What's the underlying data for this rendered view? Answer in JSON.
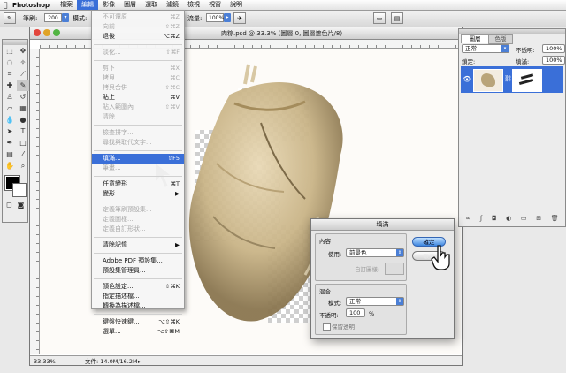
{
  "menubar": {
    "app": "Photoshop",
    "items": [
      "檔案",
      "編輯",
      "影像",
      "圖層",
      "選取",
      "濾鏡",
      "檢視",
      "視窗",
      "說明"
    ],
    "active_index": 1
  },
  "options_bar": {
    "brush_label": "筆刷:",
    "brush_size": "200",
    "mode_label": "模式:",
    "flow_label": "流量:",
    "flow_value": "100%"
  },
  "document": {
    "title": "肉粽.psd @ 33.3% (圖層 0, 圖層遮色片/8)",
    "zoom": "33.33%",
    "file_info": "文件: 14.0M/16.2M"
  },
  "edit_menu": {
    "items": [
      {
        "label": "不可還原",
        "shortcut": "⌘Z",
        "disabled": true
      },
      {
        "label": "向前",
        "shortcut": "⇧⌘Z",
        "disabled": true
      },
      {
        "label": "退後",
        "shortcut": "⌥⌘Z",
        "disabled": false
      },
      {
        "sep": true
      },
      {
        "label": "淡化...",
        "shortcut": "⇧⌘F",
        "disabled": true
      },
      {
        "sep": true
      },
      {
        "label": "剪下",
        "shortcut": "⌘X",
        "disabled": true
      },
      {
        "label": "拷貝",
        "shortcut": "⌘C",
        "disabled": true
      },
      {
        "label": "拷貝合併",
        "shortcut": "⇧⌘C",
        "disabled": true
      },
      {
        "label": "貼上",
        "shortcut": "⌘V",
        "disabled": false
      },
      {
        "label": "貼入範圍內",
        "shortcut": "⇧⌘V",
        "disabled": true
      },
      {
        "label": "清除",
        "shortcut": "",
        "disabled": true
      },
      {
        "sep": true
      },
      {
        "label": "檢查拼字...",
        "shortcut": "",
        "disabled": true
      },
      {
        "label": "尋找與取代文字...",
        "shortcut": "",
        "disabled": true
      },
      {
        "sep": true
      },
      {
        "label": "填滿...",
        "shortcut": "⇧F5",
        "disabled": false,
        "highlighted": true
      },
      {
        "label": "筆畫...",
        "shortcut": "",
        "disabled": true
      },
      {
        "sep": true
      },
      {
        "label": "任意變形",
        "shortcut": "⌘T",
        "disabled": false
      },
      {
        "label": "變形",
        "shortcut": "▶",
        "disabled": false
      },
      {
        "sep": true
      },
      {
        "label": "定義筆刷預設集...",
        "shortcut": "",
        "disabled": true
      },
      {
        "label": "定義圖樣...",
        "shortcut": "",
        "disabled": true
      },
      {
        "label": "定義自訂形狀...",
        "shortcut": "",
        "disabled": true
      },
      {
        "sep": true
      },
      {
        "label": "清除記憶",
        "shortcut": "▶",
        "disabled": false
      },
      {
        "sep": true
      },
      {
        "label": "Adobe PDF 預設集...",
        "shortcut": "",
        "disabled": false
      },
      {
        "label": "預設集管理員...",
        "shortcut": "",
        "disabled": false
      },
      {
        "sep": true
      },
      {
        "label": "顏色設定...",
        "shortcut": "⇧⌘K",
        "disabled": false
      },
      {
        "label": "指定描述檔...",
        "shortcut": "",
        "disabled": false
      },
      {
        "label": "轉換為描述檔...",
        "shortcut": "",
        "disabled": false
      },
      {
        "sep": true
      },
      {
        "label": "鍵盤快速鍵...",
        "shortcut": "⌥⇧⌘K",
        "disabled": false
      },
      {
        "label": "選單...",
        "shortcut": "⌥⇧⌘M",
        "disabled": false
      }
    ]
  },
  "layers_panel": {
    "tabs": [
      "圖層",
      "色版"
    ],
    "blend_mode": "正常",
    "opacity_label": "不透明:",
    "opacity_value": "100%",
    "lock_label": "鎖定:",
    "fill_label": "填滿:",
    "fill_value": "100%"
  },
  "fill_dialog": {
    "title": "填滿",
    "content_group": "內容",
    "use_label": "使用:",
    "use_value": "前景色",
    "custom_pattern_label": "自訂圖樣:",
    "blend_group": "混合",
    "mode_label": "模式:",
    "mode_value": "正常",
    "opacity_label": "不透明:",
    "opacity_value": "100",
    "opacity_unit": "%",
    "preserve_label": "保留透明",
    "ok_label": "確定",
    "cancel_label": "取消"
  }
}
